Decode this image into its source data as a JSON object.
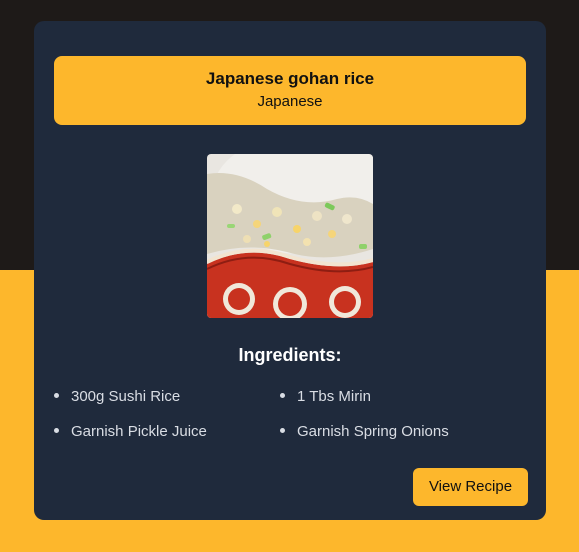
{
  "card": {
    "title": "Japanese gohan rice",
    "cuisine": "Japanese",
    "ingredients_heading": "Ingredients:",
    "ingredients": [
      "300g Sushi Rice",
      "1 Tbs Mirin",
      "Garnish Pickle Juice",
      "Garnish Spring Onions"
    ],
    "view_recipe_label": "View Recipe"
  },
  "colors": {
    "accent": "#fdb72c",
    "card_background": "#1f2a3c",
    "page_top_background": "#1e1a18"
  }
}
